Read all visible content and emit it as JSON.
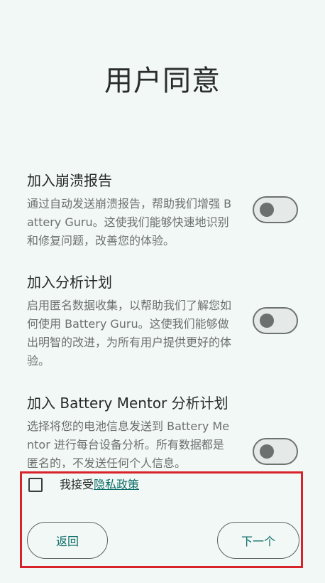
{
  "header": {
    "title": "用户同意"
  },
  "settings": [
    {
      "title": "加入崩溃报告",
      "description": "通过自动发送崩溃报告，帮助我们增强 Battery Guru。这使我们能够快速地识别和修复问题，改善您的体验。",
      "enabled": false
    },
    {
      "title": "加入分析计划",
      "description": "启用匿名数据收集，以帮助我们了解您如何使用 Battery Guru。这使我们能够做出明智的改进，为所有用户提供更好的体验。",
      "enabled": false
    },
    {
      "title": "加入 Battery Mentor 分析计划",
      "description": "选择将您的电池信息发送到 Battery Mentor 进行每台设备分析。所有数据都是匿名的，不发送任何个人信息。",
      "enabled": false
    }
  ],
  "consent": {
    "accept_prefix": "我接受",
    "privacy_link": "隐私政策",
    "checked": false
  },
  "buttons": {
    "back": "返回",
    "next": "下一个"
  },
  "colors": {
    "background": "#f2f8f5",
    "accent": "#0e6d69",
    "highlight": "#d8232a"
  }
}
